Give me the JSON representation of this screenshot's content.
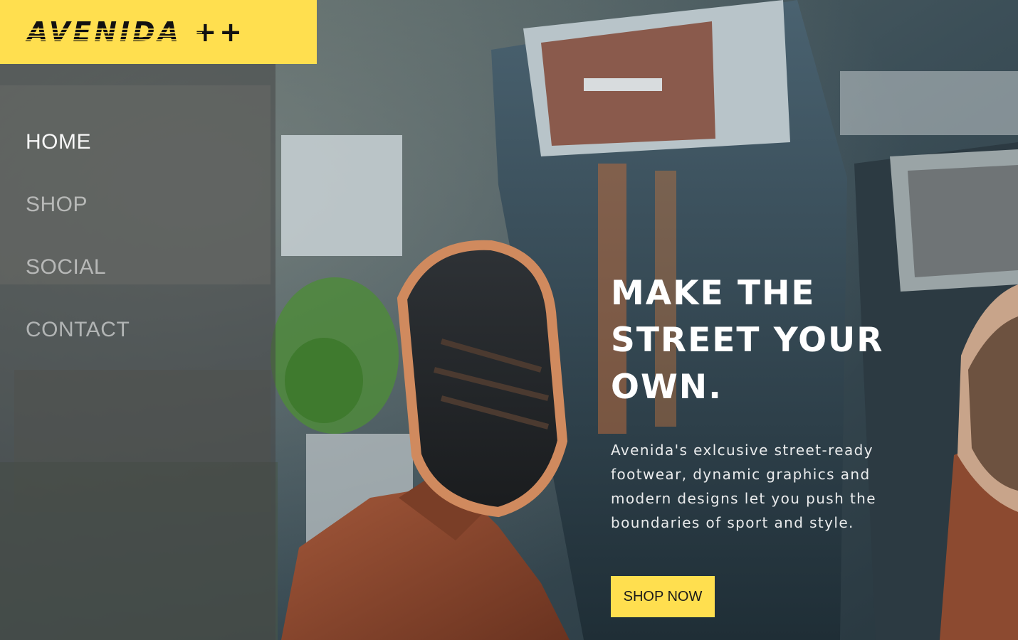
{
  "brand": {
    "logo_text": "AVENIDA ++",
    "accent_color": "#ffdf4f"
  },
  "nav": {
    "items": [
      {
        "label": "HOME",
        "active": true
      },
      {
        "label": "SHOP",
        "active": false
      },
      {
        "label": "SOCIAL",
        "active": false
      },
      {
        "label": "CONTACT",
        "active": false
      }
    ]
  },
  "hero": {
    "headline": "MAKE THE\nSTREET YOUR\nOWN.",
    "description": "Avenida's exlcusive street-ready footwear, dynamic graphics and modern designs let you push the boundaries of sport and style.",
    "cta_label": "SHOP NOW",
    "background_image": "aerial-city-sneakers-photo"
  }
}
